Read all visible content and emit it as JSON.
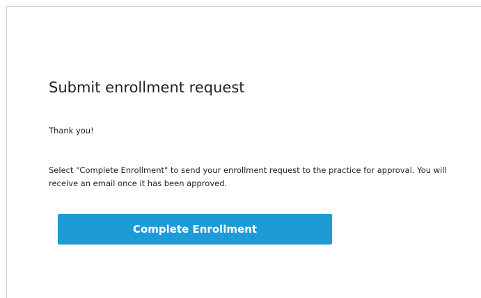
{
  "enrollment": {
    "title": "Submit enrollment request",
    "thank_you": "Thank you!",
    "instructions": "Select \"Complete Enrollment\" to send your enrollment request to the practice for approval. You will receive an email once it has been approved.",
    "complete_button_label": "Complete Enrollment"
  },
  "colors": {
    "button_background": "#1e9ad6",
    "button_text": "#ffffff",
    "panel_border": "#cfcfcf",
    "text": "#222222"
  }
}
